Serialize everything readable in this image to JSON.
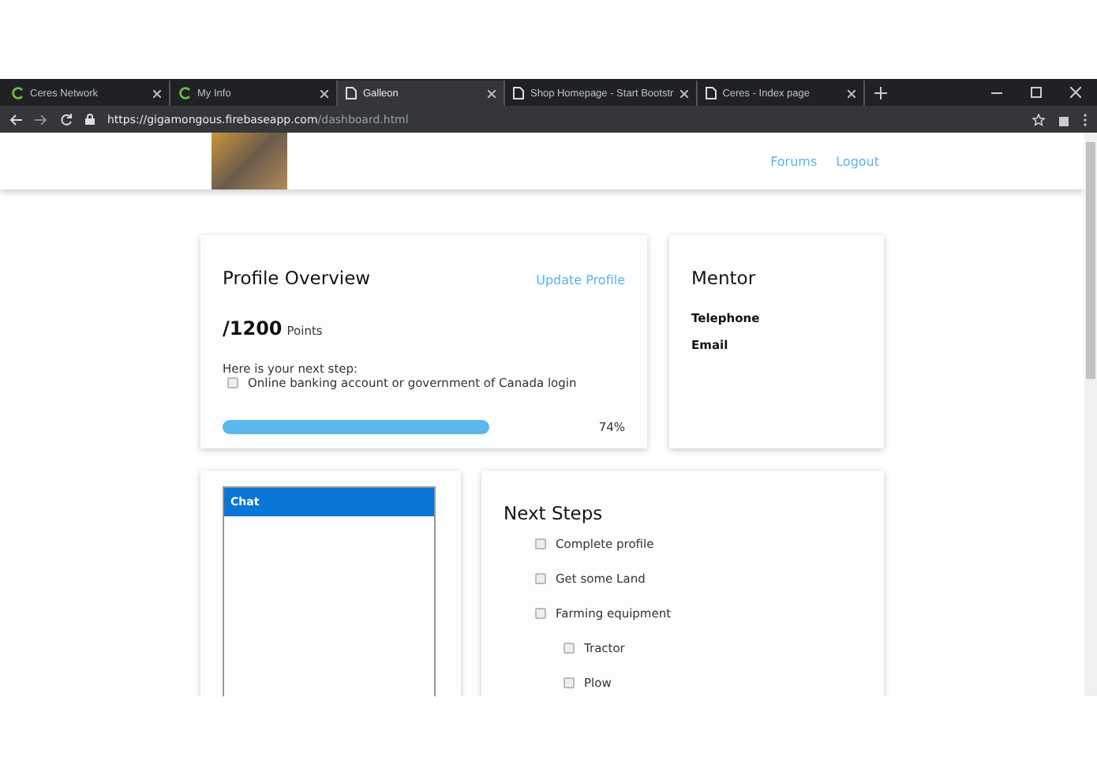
{
  "browser": {
    "tabs": [
      {
        "title": "Ceres Network",
        "kind": "logo",
        "selected": false
      },
      {
        "title": "My Info",
        "kind": "logo",
        "selected": false
      },
      {
        "title": "Galleon",
        "kind": "page",
        "selected": true
      },
      {
        "title": "Shop Homepage - Start Bootstr",
        "kind": "page",
        "selected": false
      },
      {
        "title": "Ceres - Index page",
        "kind": "page",
        "selected": false
      }
    ],
    "url_host": "https://gigamongous.firebaseapp.com",
    "url_path": "/dashboard.html"
  },
  "nav": {
    "links": [
      "Forums",
      "Logout"
    ]
  },
  "profile": {
    "title": "Profile Overview",
    "action": "Update Profile",
    "points": "/1200",
    "points_label": "Points",
    "next_step_label": "Here is your next step:",
    "next_step": {
      "label": "Online banking account or government of Canada login",
      "checked": false
    },
    "level": 0.74,
    "reading": "74%"
  },
  "mentor": {
    "title": "Mentor",
    "fields": [
      "Telephone",
      "Email"
    ]
  },
  "chat": {
    "title": "Chat"
  },
  "next_steps": {
    "title": "Next Steps",
    "items": [
      {
        "label": "Complete profile",
        "checked": false
      },
      {
        "label": "Get some Land",
        "checked": false
      },
      {
        "label": "Farming equipment",
        "checked": false,
        "children": [
          {
            "label": "Tractor",
            "checked": false
          },
          {
            "label": "Plow",
            "checked": false
          }
        ]
      }
    ]
  }
}
